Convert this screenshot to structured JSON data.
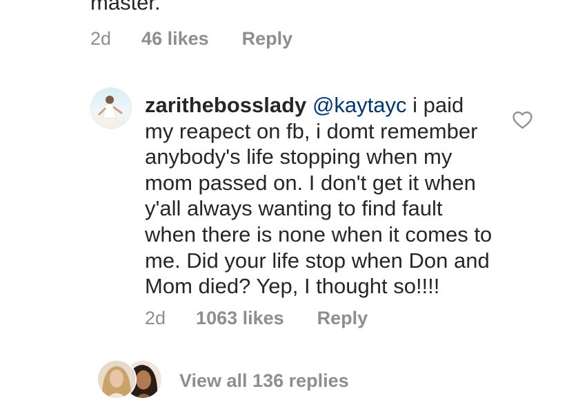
{
  "previous_comment": {
    "text_tail": "master.",
    "time": "2d",
    "likes": "46 likes",
    "reply_label": "Reply"
  },
  "comment": {
    "username": "zarithebosslady",
    "mention": "@kaytayc",
    "body": " i paid my reapect on fb, i domt remember anybody's life stopping when my mom passed on. I don't get it when y'all always wanting to find fault when there is none when it comes to me. Did your life stop when Don and Mom died? Yep, I thought so!!!!",
    "time": "2d",
    "likes": "1063 likes",
    "reply_label": "Reply",
    "like_icon": "heart-outline-icon"
  },
  "replies": {
    "view_all_label": "View all 136 replies"
  },
  "colors": {
    "text_primary": "#262626",
    "text_secondary": "#8e8e8e",
    "mention": "#00376b",
    "background": "#ffffff"
  }
}
